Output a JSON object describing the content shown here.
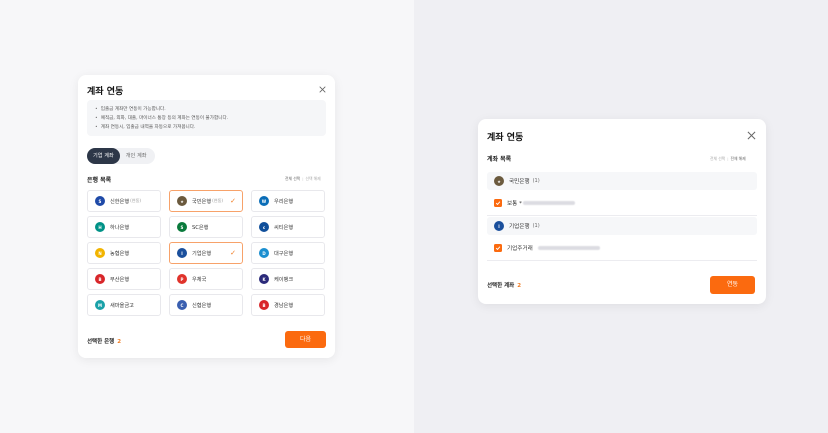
{
  "left": {
    "title": "계좌 연동",
    "notices": [
      "입출금 계좌만 연동이 가능합니다.",
      "예적금, 외화, 대출, 마이너스 통장 등의 계좌는 연동이 불가합니다.",
      "계좌 연동시, 입출금 내역을 자동으로 가져옵니다."
    ],
    "tabs": [
      {
        "label": "기업 계좌",
        "active": true
      },
      {
        "label": "개인 계좌",
        "active": false
      }
    ],
    "section_title": "은행 목록",
    "select_all": "전체 선택",
    "deselect_all": "선택 해제",
    "banks": [
      {
        "name": "신한은행",
        "tag": "(연동)",
        "selected": false,
        "color": "#1f4aa8",
        "icon": "shinhan"
      },
      {
        "name": "국민은행",
        "tag": "(연동)",
        "selected": true,
        "color": "#6b5a3e",
        "icon": "kb"
      },
      {
        "name": "우리은행",
        "tag": "",
        "selected": false,
        "color": "#0a6db7",
        "icon": "woori"
      },
      {
        "name": "하나은행",
        "tag": "",
        "selected": false,
        "color": "#009287",
        "icon": "hana"
      },
      {
        "name": "SC은행",
        "tag": "",
        "selected": false,
        "color": "#0a7a3c",
        "icon": "sc"
      },
      {
        "name": "씨티은행",
        "tag": "",
        "selected": false,
        "color": "#0f4e9a",
        "icon": "citi"
      },
      {
        "name": "농협은행",
        "tag": "",
        "selected": false,
        "color": "#f2b400",
        "icon": "nh"
      },
      {
        "name": "기업은행",
        "tag": "",
        "selected": true,
        "color": "#1a4f9c",
        "icon": "ibk"
      },
      {
        "name": "대구은행",
        "tag": "",
        "selected": false,
        "color": "#1b8fd0",
        "icon": "dgb"
      },
      {
        "name": "부산은행",
        "tag": "",
        "selected": false,
        "color": "#d8262a",
        "icon": "bnk"
      },
      {
        "name": "우체국",
        "tag": "",
        "selected": false,
        "color": "#e0332b",
        "icon": "post"
      },
      {
        "name": "케이뱅크",
        "tag": "",
        "selected": false,
        "color": "#2b2a7a",
        "icon": "kbank"
      },
      {
        "name": "새마을금고",
        "tag": "",
        "selected": false,
        "color": "#1aa1a8",
        "icon": "mg"
      },
      {
        "name": "신협은행",
        "tag": "",
        "selected": false,
        "color": "#3a5fb0",
        "icon": "cu"
      },
      {
        "name": "경남은행",
        "tag": "",
        "selected": false,
        "color": "#d8262a",
        "icon": "knb"
      }
    ],
    "selected_label": "선택한 은행",
    "selected_count": "2",
    "next_label": "다음"
  },
  "right": {
    "title": "계좌 연동",
    "section_title": "계좌 목록",
    "select_all": "전체 선택",
    "deselect_all": "전체 해제",
    "rows": [
      {
        "type": "bank",
        "name": "국민은행",
        "count": "(1)",
        "color": "#6b5a3e",
        "icon": "kb"
      },
      {
        "type": "account",
        "name": "보통 *",
        "checked": true
      },
      {
        "type": "bank",
        "name": "기업은행",
        "count": "(1)",
        "color": "#1a4f9c",
        "icon": "ibk"
      },
      {
        "type": "account",
        "name": "기업주거래",
        "checked": true
      }
    ],
    "selected_label": "선택한 계좌",
    "selected_count": "2",
    "link_label": "연동"
  }
}
